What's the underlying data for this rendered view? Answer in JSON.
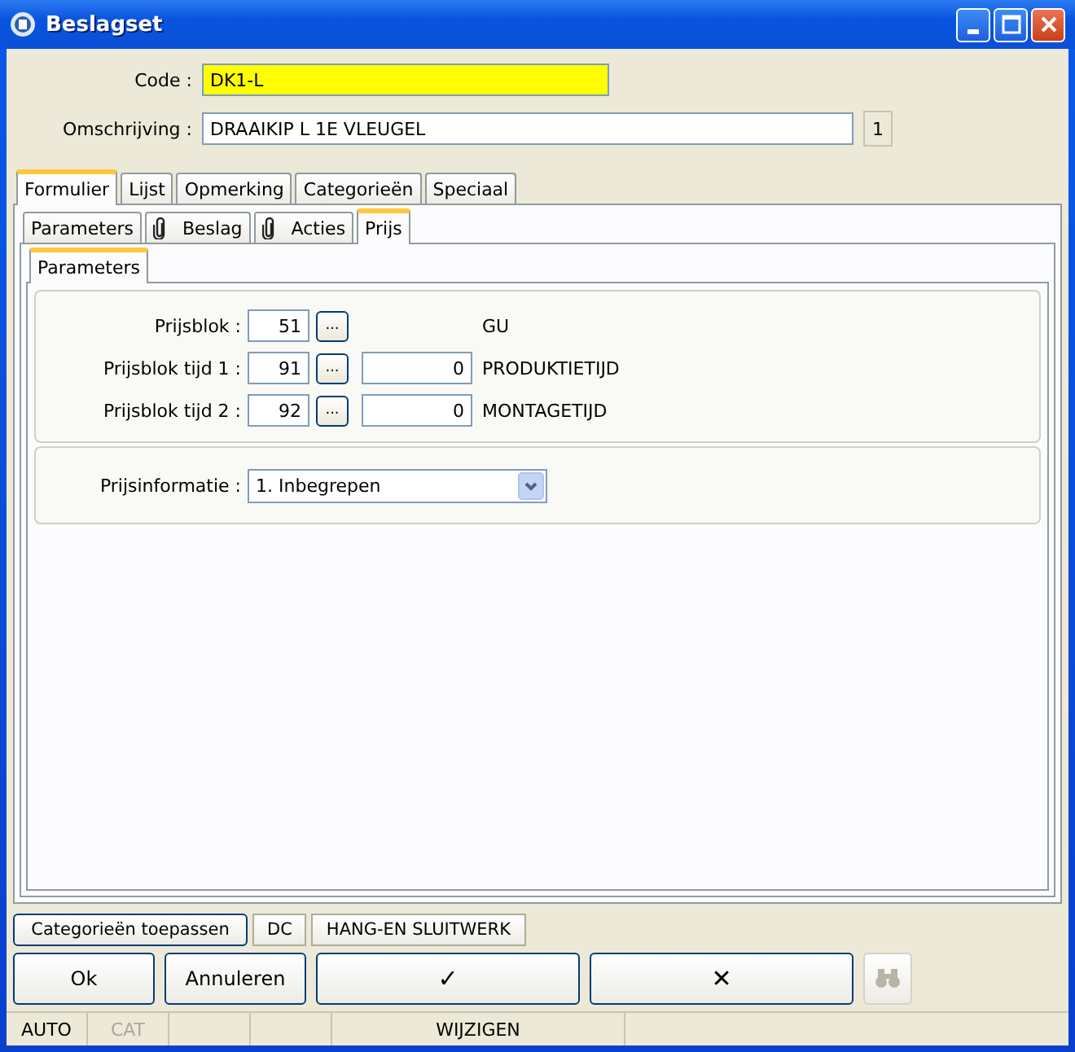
{
  "window": {
    "title": "Beslagset"
  },
  "header": {
    "code_label": "Code :",
    "code_value": "DK1-L",
    "description_label": "Omschrijving :",
    "description_value": "DRAAIKIP L 1E VLEUGEL",
    "count": "1"
  },
  "tabs": [
    {
      "label": "Formulier",
      "selected": true
    },
    {
      "label": "Lijst",
      "selected": false
    },
    {
      "label": "Opmerking",
      "selected": false
    },
    {
      "label": "Categorieën",
      "selected": false
    },
    {
      "label": "Speciaal",
      "selected": false
    }
  ],
  "subtabs": [
    {
      "label": "Parameters",
      "selected": false,
      "kind": "plain"
    },
    {
      "label": "Beslag",
      "selected": false,
      "kind": "paperclip"
    },
    {
      "label": "Acties",
      "selected": false,
      "kind": "paperclip"
    },
    {
      "label": "Prijs",
      "selected": true,
      "kind": "plain"
    }
  ],
  "inner_tab": {
    "label": "Parameters",
    "selected": true
  },
  "price_rows": [
    {
      "label": "Prijsblok :",
      "value": "51",
      "time": null,
      "name": "GU"
    },
    {
      "label": "Prijsblok tijd 1 :",
      "value": "91",
      "time": "0",
      "name": "PRODUKTIETIJD"
    },
    {
      "label": "Prijsblok tijd 2 :",
      "value": "92",
      "time": "0",
      "name": "MONTAGETIJD"
    }
  ],
  "browse_button": "...",
  "price_info": {
    "label": "Prijsinformatie :",
    "value": "1.  Inbegrepen"
  },
  "category_buttons": [
    "Categorieën toepassen",
    "DC",
    "HANG-EN SLUITWERK"
  ],
  "buttons": [
    {
      "label": "Ok",
      "kind": "text"
    },
    {
      "label": "Annuleren",
      "kind": "text"
    },
    {
      "label": "✓",
      "kind": "wide"
    },
    {
      "label": "✕",
      "kind": "wide"
    },
    {
      "kind": "search",
      "disabled": true
    }
  ],
  "status_bar": [
    {
      "text": "AUTO",
      "disabled": false
    },
    {
      "text": "CAT",
      "disabled": true
    },
    {
      "text": "WIJZIGEN",
      "disabled": false
    }
  ]
}
